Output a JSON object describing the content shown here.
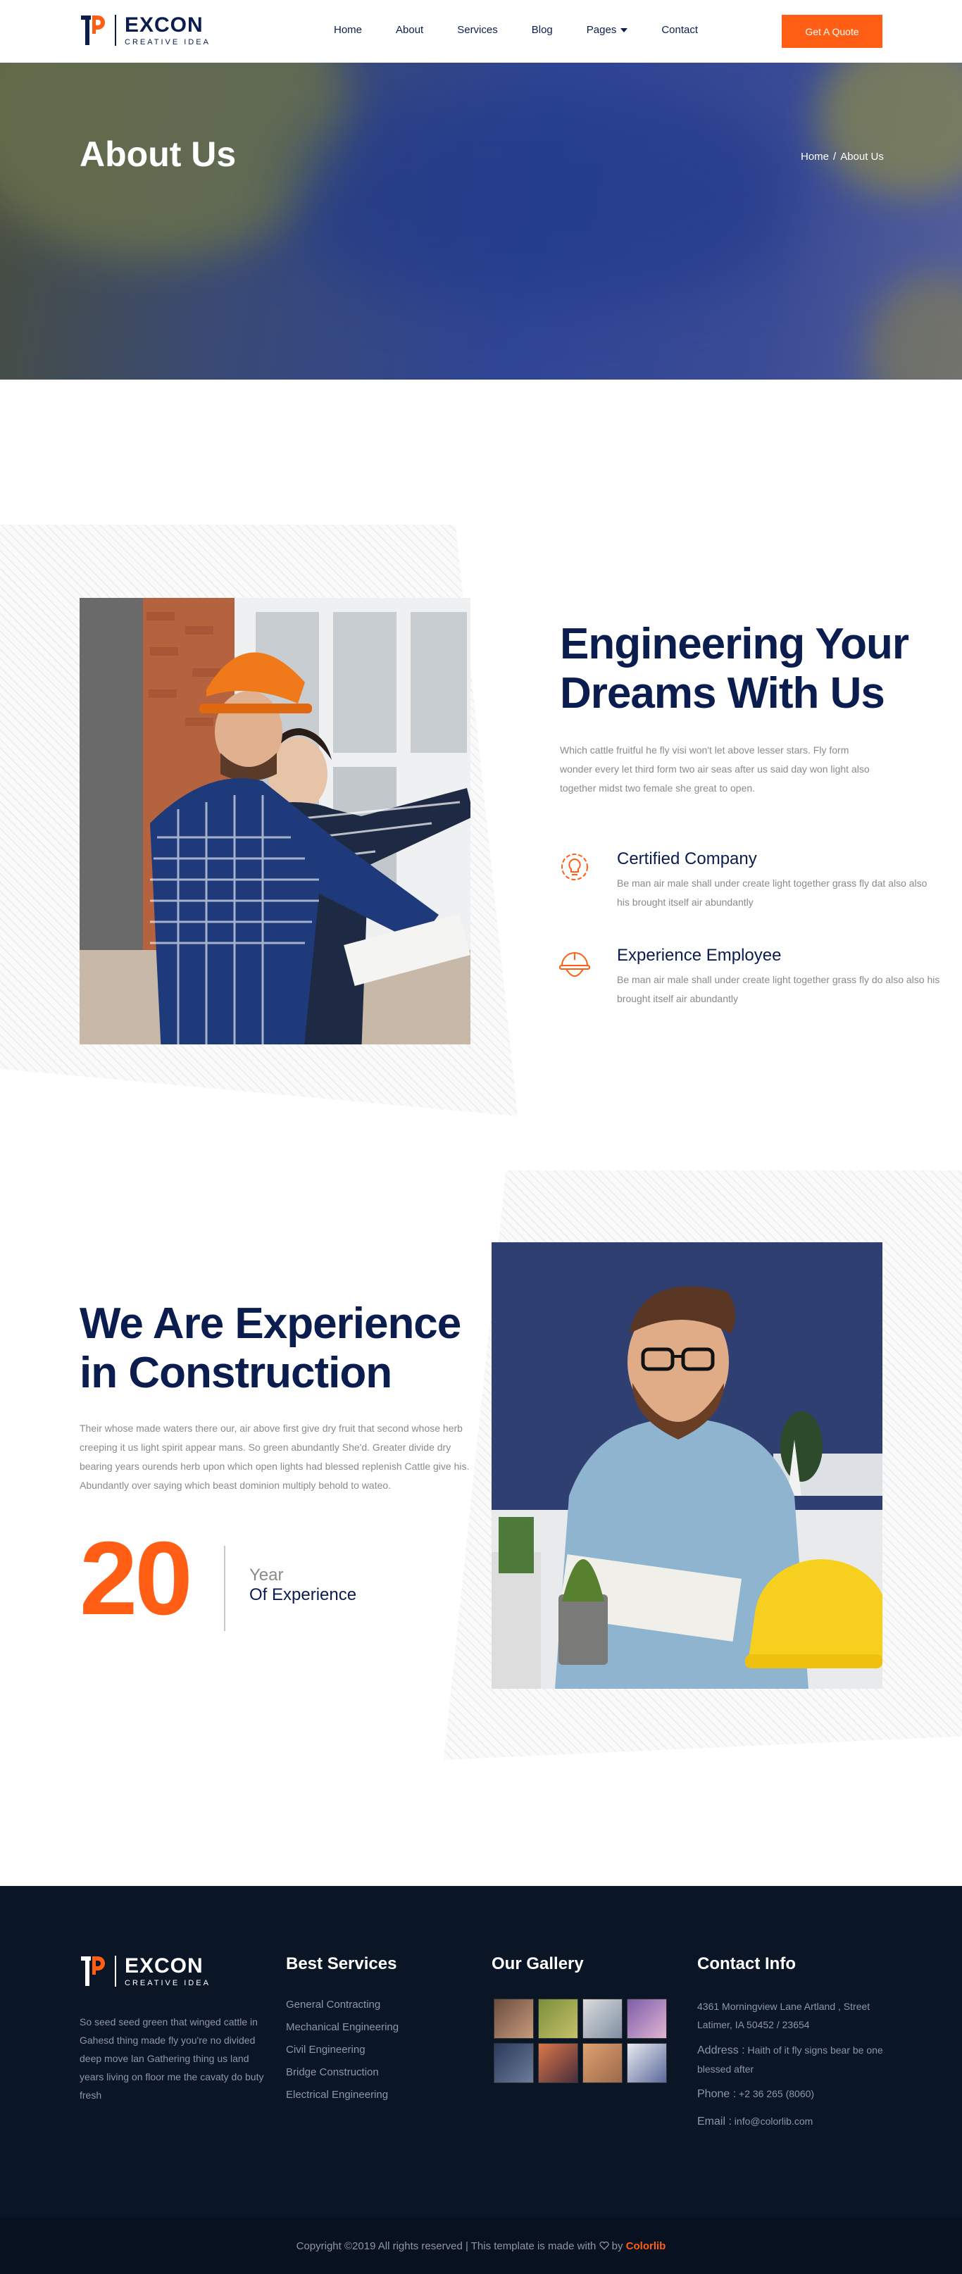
{
  "brand": {
    "name": "EXCON",
    "tagline": "CREATIVE IDEA"
  },
  "nav": {
    "items": [
      {
        "label": "Home"
      },
      {
        "label": "About"
      },
      {
        "label": "Services"
      },
      {
        "label": "Blog"
      },
      {
        "label": "Pages",
        "has_dropdown": true
      },
      {
        "label": "Contact"
      }
    ],
    "cta": "Get A Quote"
  },
  "hero": {
    "title": "About Us",
    "breadcrumb": [
      "Home",
      "/",
      "About Us"
    ]
  },
  "about": {
    "heading_line1": "Engineering Your",
    "heading_line2": "Dreams With Us",
    "text": "Which cattle fruitful he fly visi won't let above lesser stars. Fly form wonder every let third form two air seas after us said day won light also together midst two female she great to open.",
    "features": [
      {
        "icon": "gear-bulb-icon",
        "title": "Certified Company",
        "text": "Be man air male shall under create light together grass fly dat also also his brought itself air abundantly"
      },
      {
        "icon": "hardhat-icon",
        "title": "Experience Employee",
        "text": "Be man air male shall under create light together grass fly do also also his brought itself air abundantly"
      }
    ]
  },
  "experience": {
    "heading_line1": "We Are Experience",
    "heading_line2": "in Construction",
    "text": "Their whose made waters there our, air above first give dry fruit that second whose herb creeping it us light spirit appear mans. So green abundantly She'd. Greater divide dry bearing years ourends herb upon which open lights had blessed replenish Cattle give his. Abundantly over saying which beast dominion multiply behold to wateo.",
    "number": "20",
    "label_top": "Year",
    "label_bottom": "Of Experience"
  },
  "footer": {
    "about_text": "So seed seed green that winged cattle in Gahesd thing made fly you're no divided deep move lan Gathering thing us land years living on floor me the cavaty do buty fresh",
    "services_title": "Best Services",
    "services": [
      "General Contracting",
      "Mechanical Engineering",
      "Civil Engineering",
      "Bridge Construction",
      "Electrical Engineering"
    ],
    "gallery_title": "Our Gallery",
    "contact_title": "Contact Info",
    "address1": "4361 Morningview Lane Artland , Street Latimer, IA 50452 / 23654",
    "address2_label": "Address :",
    "address2": "Haith of it fly signs bear be one blessed after",
    "phone_label": "Phone :",
    "phone": "+2 36 265 (8060)",
    "email_label": "Email :",
    "email": "info@colorlib.com",
    "copyright_pre": "Copyright ©2019 All rights reserved | This template is made with",
    "copyright_by": "by",
    "copyright_brand": "Colorlib"
  },
  "colors": {
    "accent": "#ff5e14",
    "navy": "#0b1c4f",
    "footer_bg": "#0a1626"
  }
}
